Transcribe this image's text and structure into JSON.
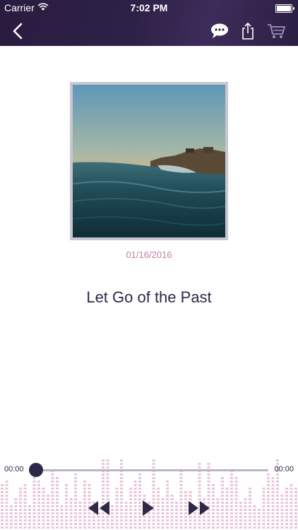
{
  "status_bar": {
    "carrier": "Carrier",
    "time": "7:02 PM"
  },
  "nav": {
    "icons": [
      "back-chevron-icon",
      "chat-bubble-icon",
      "share-icon",
      "cart-icon"
    ]
  },
  "track": {
    "date": "01/16/2016",
    "title": "Let Go of the Past"
  },
  "player": {
    "elapsed": "00:00",
    "duration": "00:00",
    "progress": 0,
    "controls": [
      "rewind-icon",
      "play-icon",
      "fast-forward-icon"
    ]
  },
  "colors": {
    "navbar": "#2e2147",
    "accent_dark": "#2e2947",
    "date_pink": "#c07fa6",
    "visualizer_pink": "#e9c6d9"
  }
}
